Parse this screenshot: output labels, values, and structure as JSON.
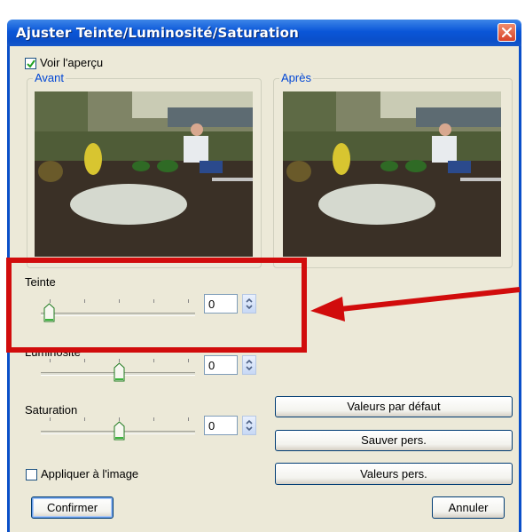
{
  "dialog": {
    "title": "Ajuster Teinte/Luminosité/Saturation"
  },
  "preview": {
    "checkbox_label": "Voir l'aperçu",
    "checked": true
  },
  "panels": {
    "before_label": "Avant",
    "after_label": "Après"
  },
  "sliders": [
    {
      "label": "Teinte",
      "value": "0",
      "position_fraction": 0.0
    },
    {
      "label": "Luminosité",
      "value": "0",
      "position_fraction": 0.5
    },
    {
      "label": "Saturation",
      "value": "0",
      "position_fraction": 0.5
    }
  ],
  "apply_checkbox": {
    "label": "Appliquer à l'image",
    "checked": false
  },
  "buttons": {
    "defaults": "Valeurs par défaut",
    "save_custom": "Sauver pers.",
    "custom_values": "Valeurs pers.",
    "confirm": "Confirmer",
    "cancel": "Annuler"
  },
  "annotation": {
    "box_color": "#d10c0c",
    "arrow_color": "#d10c0c"
  },
  "colors": {
    "title_bar": "#0a4fc9",
    "dialog_bg": "#ece9d8",
    "group_title": "#0046d5"
  }
}
